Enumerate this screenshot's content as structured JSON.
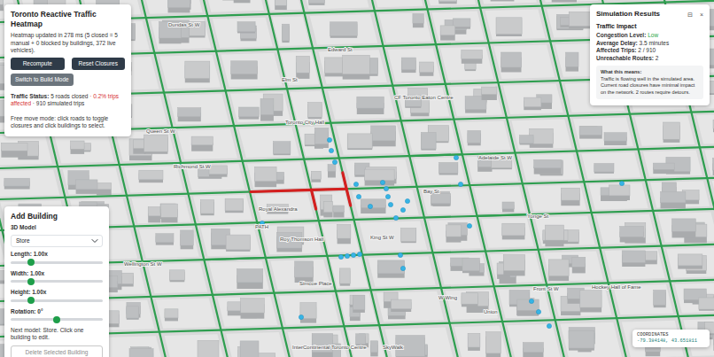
{
  "control_panel": {
    "title": "Toronto Reactive Traffic Heatmap",
    "update_info": "Heatmap updated in 278 ms (5 closed = 5 manual + 0 blocked by buildings, 372 live vehicles).",
    "buttons": [
      {
        "label": "Recompute",
        "kind": "dark"
      },
      {
        "label": "Reset Closures",
        "kind": "dark"
      },
      {
        "label": "Switch to Build Mode",
        "kind": "secondary"
      }
    ],
    "status": {
      "label": "Traffic Status:",
      "closed": "5 roads closed",
      "affected": "· 0.2% trips affected",
      "simulated": "· 910 simulated trips"
    },
    "hint": "Free move mode: click roads to toggle closures and click buildings to select."
  },
  "add_building": {
    "title": "Add Building",
    "model_label": "3D Model",
    "model_value": "Store",
    "sliders": [
      {
        "label": "Length: 1.00x",
        "level": 0.2
      },
      {
        "label": "Width: 1.00x",
        "level": 0.2
      },
      {
        "label": "Height: 1.00x",
        "level": 0.2
      },
      {
        "label": "Rotation: 0°",
        "level": 0.5
      }
    ],
    "hint": "Next model: Store. Click one building to edit.",
    "delete_button": {
      "label": "Delete Selected Building",
      "disabled": true
    }
  },
  "results": {
    "title": "Simulation Results",
    "controls": [
      "⊟",
      "×"
    ],
    "section": "Traffic Impact",
    "metrics": [
      {
        "label": "Congestion Level:",
        "value": "Low",
        "color": "#28a745"
      },
      {
        "label": "Average Delay:",
        "value": "3.5 minutes",
        "color": "#333333"
      },
      {
        "label": "Affected Trips:",
        "value": "2 / 910",
        "color": "#333333"
      },
      {
        "label": "Unreachable Routes:",
        "value": "2",
        "color": "#333333"
      }
    ],
    "explain": {
      "title": "What this means:",
      "text": "Traffic is flowing well in the simulated area. Current road closures have minimal impact on the network. 2 routes require detours."
    }
  },
  "coordinates": {
    "label": "COORDINATES",
    "value": "-79.384148, 43.651811"
  },
  "map": {
    "labels": [
      "Dundas St W",
      "Edward St",
      "Elm St",
      "CF Toronto Eaton Centre",
      "Toronto City Hall",
      "Queen St W",
      "Richmond St W",
      "Adelaide St W",
      "Royal Alexandra",
      "PATH",
      "Roy Thomson Hall",
      "King St W",
      "Wellington St W",
      "Simcoe Place",
      "Bay St",
      "Yonge St",
      "Front St W",
      "W Wing",
      "Union",
      "Hockey Hall of Fame",
      "InterContinental Toronto Centre",
      "SkyWalk"
    ],
    "road_segments": [
      {
        "closed": true
      },
      {
        "closed": true
      },
      {
        "closed": true
      },
      {
        "closed": true
      },
      {
        "closed": true
      },
      {
        "closed": false
      },
      {
        "closed": false
      },
      {
        "closed": false
      }
    ]
  }
}
